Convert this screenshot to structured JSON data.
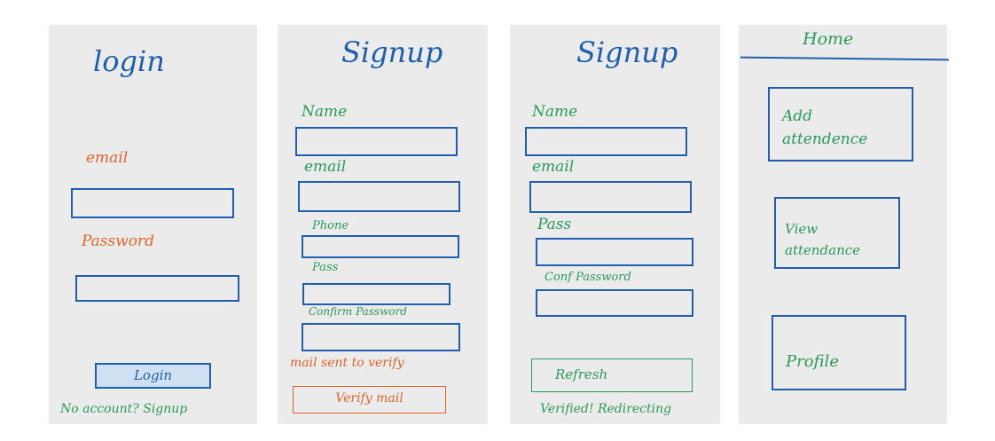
{
  "login_screen": {
    "title": "login",
    "email_label": "email",
    "password_label": "Password",
    "login_button": "Login",
    "signup_prompt": "No account? Signup"
  },
  "signup_screen_1": {
    "title": "Signup",
    "name_label": "Name",
    "email_label": "email",
    "phone_label": "Phone",
    "pass_label": "Pass",
    "confirm_label": "Confirm Password",
    "status": "mail sent to verify",
    "verify_button": "Verify mail"
  },
  "signup_screen_2": {
    "title": "Signup",
    "name_label": "Name",
    "email_label": "email",
    "pass_label": "Pass",
    "confirm_label": "Conf Password",
    "refresh_button": "Refresh",
    "status": "Verified! Redirecting"
  },
  "home_screen": {
    "title": "Home",
    "cards": [
      "Add attendence",
      "View attendance",
      "Profile"
    ]
  },
  "colors": {
    "blue": "#1f5fad",
    "green": "#2a9a5a",
    "orange": "#e0642a",
    "panel": "#ebebeb"
  }
}
